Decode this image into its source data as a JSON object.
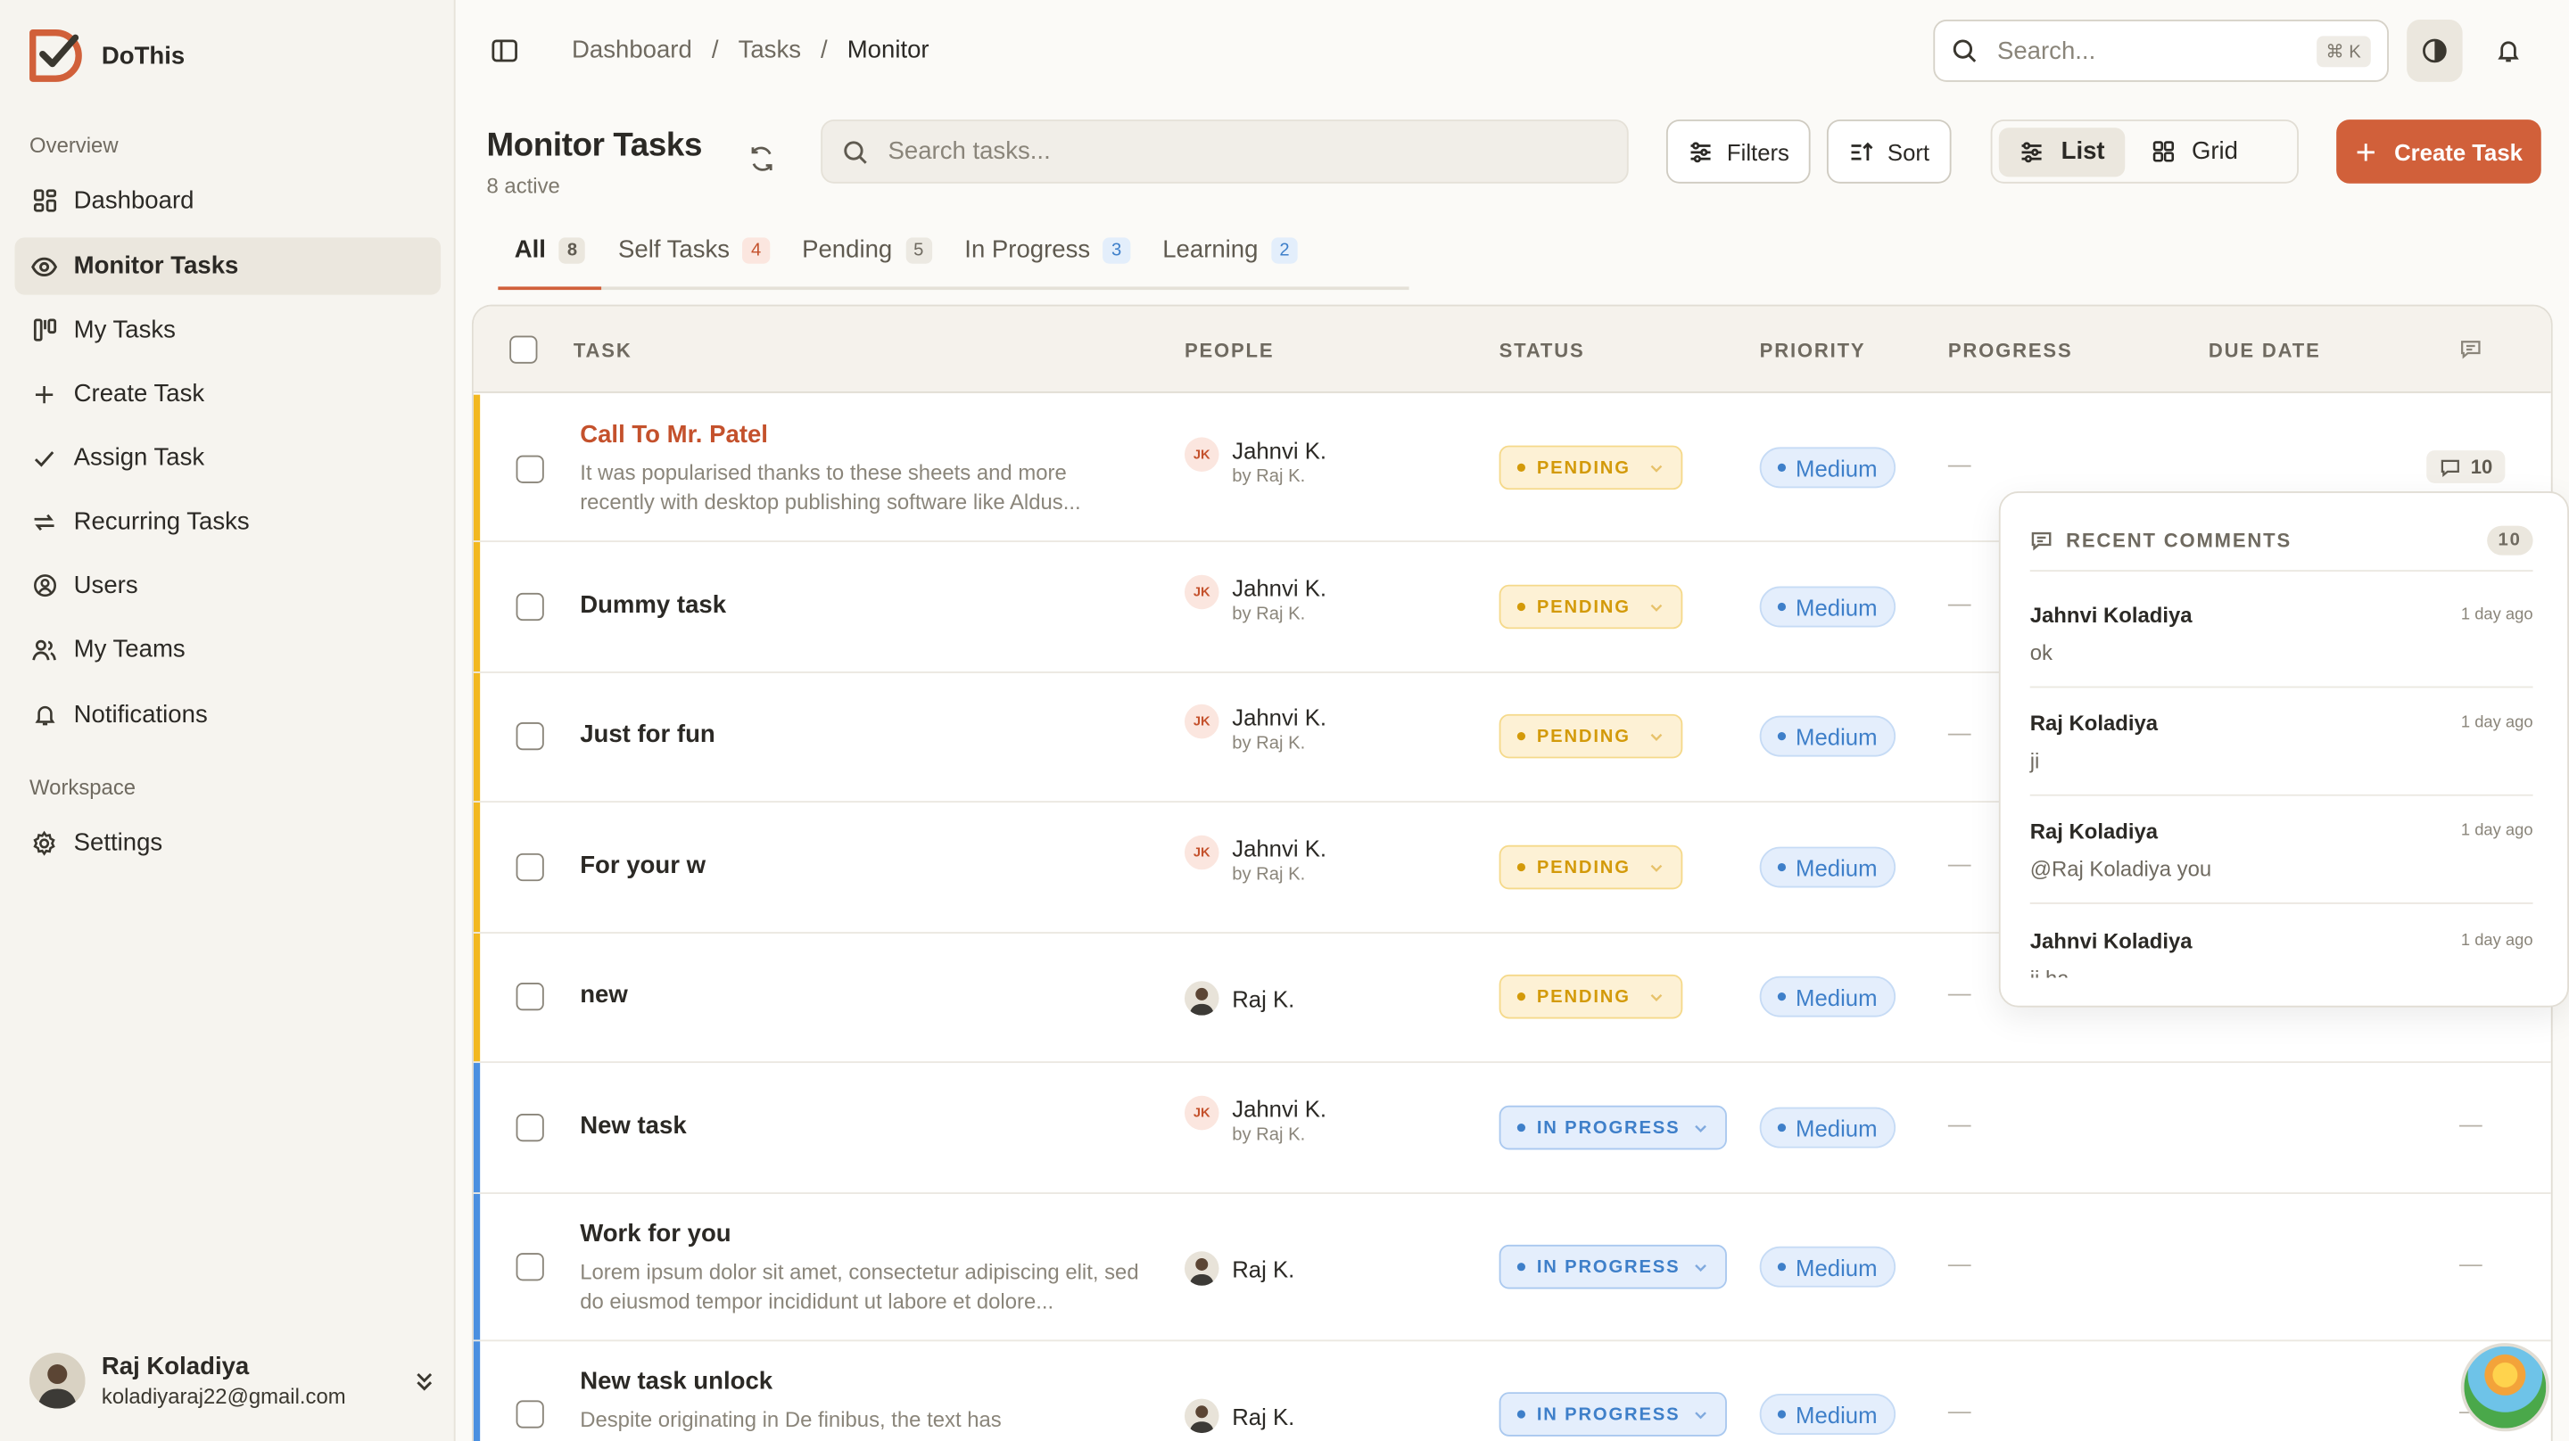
{
  "app": {
    "name": "DoThis"
  },
  "sidebar": {
    "overview_label": "Overview",
    "workspace_label": "Workspace",
    "items": [
      {
        "label": "Dashboard",
        "icon": "dashboard-icon"
      },
      {
        "label": "Monitor Tasks",
        "icon": "eye-icon",
        "active": true
      },
      {
        "label": "My Tasks",
        "icon": "kanban-icon"
      },
      {
        "label": "Create Task",
        "icon": "plus-icon"
      },
      {
        "label": "Assign Task",
        "icon": "check-icon"
      },
      {
        "label": "Recurring Tasks",
        "icon": "repeat-icon"
      },
      {
        "label": "Users",
        "icon": "user-circle-icon"
      },
      {
        "label": "My Teams",
        "icon": "users-icon"
      },
      {
        "label": "Notifications",
        "icon": "bell-icon"
      }
    ],
    "workspace_items": [
      {
        "label": "Settings",
        "icon": "gear-icon"
      }
    ],
    "user": {
      "name": "Raj Koladiya",
      "email": "koladiyaraj22@gmail.com"
    }
  },
  "topbar": {
    "breadcrumb": [
      "Dashboard",
      "Tasks",
      "Monitor"
    ],
    "search_placeholder": "Search...",
    "shortcut": "⌘ K"
  },
  "header": {
    "title": "Monitor Tasks",
    "subtitle": "8 active",
    "search_placeholder": "Search tasks...",
    "filters_label": "Filters",
    "sort_label": "Sort",
    "list_label": "List",
    "grid_label": "Grid",
    "create_label": "Create Task"
  },
  "tabs": [
    {
      "label": "All",
      "count": "8"
    },
    {
      "label": "Self Tasks",
      "count": "4"
    },
    {
      "label": "Pending",
      "count": "5"
    },
    {
      "label": "In Progress",
      "count": "3"
    },
    {
      "label": "Learning",
      "count": "2"
    }
  ],
  "table": {
    "columns": [
      "TASK",
      "PEOPLE",
      "STATUS",
      "PRIORITY",
      "PROGRESS",
      "DUE DATE"
    ],
    "rows": [
      {
        "title": "Call To Mr. Patel",
        "desc": "It was popularised thanks to these sheets and more recently with desktop publishing software like Aldus...",
        "initials": "JK",
        "person": "Jahnvi K.",
        "by": "by Raj K.",
        "status": "PENDING",
        "priority": "Medium",
        "progress": "—",
        "comments": "10"
      },
      {
        "title": "Dummy task",
        "desc": "",
        "initials": "JK",
        "person": "Jahnvi K.",
        "by": "by Raj K.",
        "status": "PENDING",
        "priority": "Medium",
        "progress": "—"
      },
      {
        "title": "Just for fun",
        "desc": "",
        "initials": "JK",
        "person": "Jahnvi K.",
        "by": "by Raj K.",
        "status": "PENDING",
        "priority": "Medium",
        "progress": "—"
      },
      {
        "title": "For your w",
        "desc": "",
        "initials": "JK",
        "person": "Jahnvi K.",
        "by": "by Raj K.",
        "status": "PENDING",
        "priority": "Medium",
        "progress": "—"
      },
      {
        "title": "new",
        "desc": "",
        "initials": "",
        "person": "Raj K.",
        "by": "",
        "status": "PENDING",
        "priority": "Medium",
        "progress": "—"
      },
      {
        "title": "New task",
        "desc": "",
        "initials": "JK",
        "person": "Jahnvi K.",
        "by": "by Raj K.",
        "status": "IN PROGRESS",
        "priority": "Medium",
        "progress": "—",
        "due": "—"
      },
      {
        "title": "Work for you",
        "desc": "Lorem ipsum dolor sit amet, consectetur adipiscing elit, sed do eiusmod tempor incididunt ut labore et dolore...",
        "initials": "",
        "person": "Raj K.",
        "by": "",
        "status": "IN PROGRESS",
        "priority": "Medium",
        "progress": "—",
        "due": "—"
      },
      {
        "title": "New task unlock",
        "desc": "Despite originating in De finibus, the text has",
        "initials": "",
        "person": "Raj K.",
        "by": "",
        "status": "IN PROGRESS",
        "priority": "Medium",
        "progress": "—",
        "due": "—"
      }
    ]
  },
  "comments": {
    "title": "RECENT COMMENTS",
    "count": "10",
    "items": [
      {
        "author": "Jahnvi Koladiya",
        "time": "1 day ago",
        "text": "ok"
      },
      {
        "author": "Raj Koladiya",
        "time": "1 day ago",
        "text": "ji"
      },
      {
        "author": "Raj Koladiya",
        "time": "1 day ago",
        "text": "@Raj Koladiya you"
      },
      {
        "author": "Jahnvi Koladiya",
        "time": "1 day ago",
        "text": "ji ha"
      }
    ]
  },
  "colors": {
    "accent": "#d1603a",
    "pending": "#d39a0a",
    "progress": "#3e7fc9",
    "pending_bar": "#f2b820",
    "progress_bar": "#4a8fe0"
  }
}
